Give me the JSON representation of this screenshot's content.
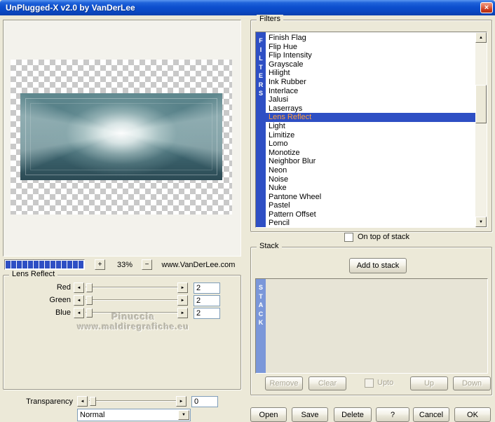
{
  "window": {
    "title": "UnPlugged-X v2.0 by VanDerLee"
  },
  "icons": {
    "close": "×",
    "left_arrow": "◄",
    "right_arrow": "►",
    "up_arrow": "▲",
    "down_arrow": "▼",
    "combo_arrow": "▼",
    "plus": "+",
    "minus": "−"
  },
  "zoom": {
    "segments": 14,
    "level": "33%",
    "website": "www.VanDerLee.com"
  },
  "lens_reflect": {
    "title": "Lens Reflect",
    "sliders": [
      {
        "label": "Red",
        "value": "2"
      },
      {
        "label": "Green",
        "value": "2"
      },
      {
        "label": "Blue",
        "value": "2"
      }
    ]
  },
  "watermark": {
    "line1": "Pinuccia",
    "line2": "www.maldiregrafiche.eu"
  },
  "transparency": {
    "label": "Transparency",
    "value": "0"
  },
  "blend": {
    "selected": "Normal"
  },
  "filters": {
    "title": "Filters",
    "vertical_label": "F\nI\nL\nT\nE\nR\nS",
    "items": [
      "Finish Flag",
      "Flip Hue",
      "Flip Intensity",
      "Grayscale",
      "Hilight",
      "Ink Rubber",
      "Interlace",
      "Jalusi",
      "Laserrays",
      "Lens Reflect",
      "Light",
      "Limitize",
      "Lomo",
      "Monotize",
      "Neighbor Blur",
      "Neon",
      "Noise",
      "Nuke",
      "Pantone Wheel",
      "Pastel",
      "Pattern Offset",
      "Pencil"
    ],
    "selected": "Lens Reflect",
    "on_top_label": "On top of stack"
  },
  "stack": {
    "title": "Stack",
    "vertical_label": "S\nT\nA\nC\nK",
    "add_button": "Add to stack",
    "remove_button": "Remove",
    "clear_button": "Clear",
    "upto_label": "Upto",
    "up_button": "Up",
    "down_button": "Down"
  },
  "footer": {
    "open": "Open",
    "save": "Save",
    "delete": "Delete",
    "help": "?",
    "cancel": "Cancel",
    "ok": "OK"
  },
  "colors": {
    "accent_blue": "#2e4fc4",
    "stack_bar_blue": "#7b97d9",
    "selected_text": "#ff9e3d",
    "dialog_bg": "#ece9d8"
  }
}
